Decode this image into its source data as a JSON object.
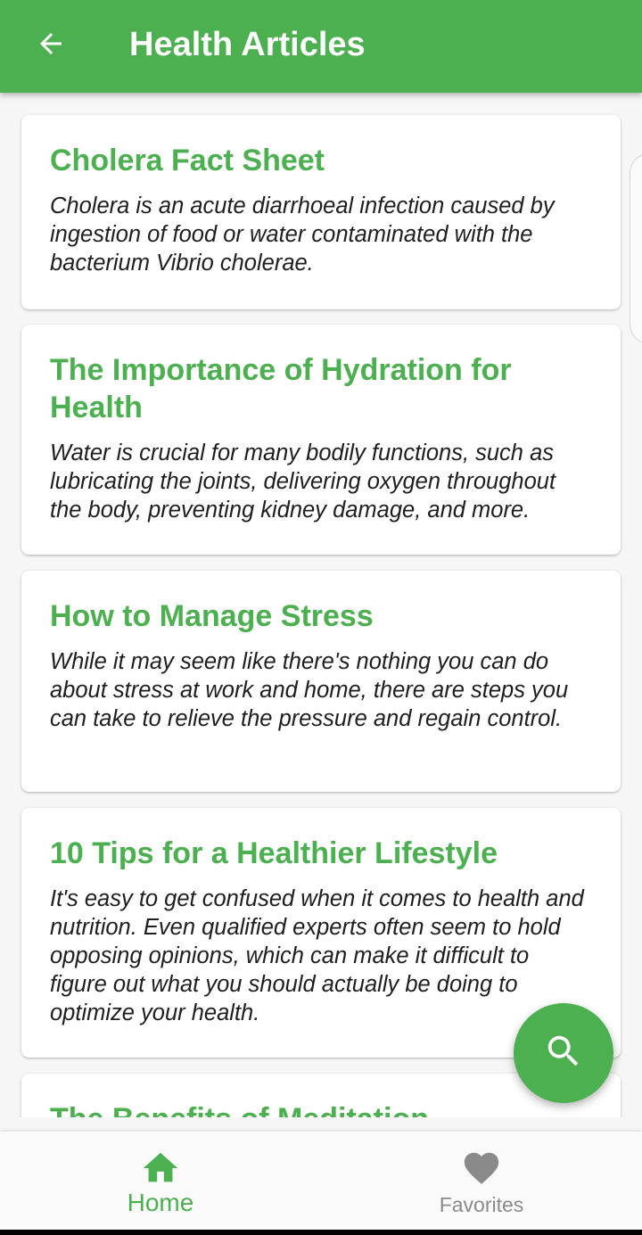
{
  "appbar": {
    "title": "Health Articles",
    "back_icon": "arrow-back-icon",
    "background": "#4caf50"
  },
  "articles": [
    {
      "title": "Cholera Fact Sheet",
      "summary": "Cholera is an acute diarrhoeal infection caused by ingestion of food or water contaminated with the bacterium Vibrio cholerae."
    },
    {
      "title": "The Importance of Hydration for Health",
      "summary": "Water is crucial for many bodily functions, such as lubricating the joints, delivering oxygen throughout the body, preventing kidney damage, and more."
    },
    {
      "title": "How to Manage Stress",
      "summary": "While it may seem like there's nothing you can do about stress at work and home, there are steps you can take to relieve the pressure and regain control."
    },
    {
      "title": "10 Tips for a Healthier Lifestyle",
      "summary": "It's easy to get confused when it comes to health and nutrition. Even qualified experts often seem to hold opposing opinions, which can make it difficult to figure out what you should actually be doing to optimize your health."
    },
    {
      "title": "The Benefits of Meditation",
      "summary": ""
    }
  ],
  "fab": {
    "icon": "search-icon"
  },
  "bottom_nav": {
    "items": [
      {
        "label": "Home",
        "icon": "home-icon",
        "active": true
      },
      {
        "label": "Favorites",
        "icon": "heart-icon",
        "active": false
      }
    ]
  },
  "colors": {
    "accent": "#4caf50",
    "inactive": "#8a8a8a"
  }
}
